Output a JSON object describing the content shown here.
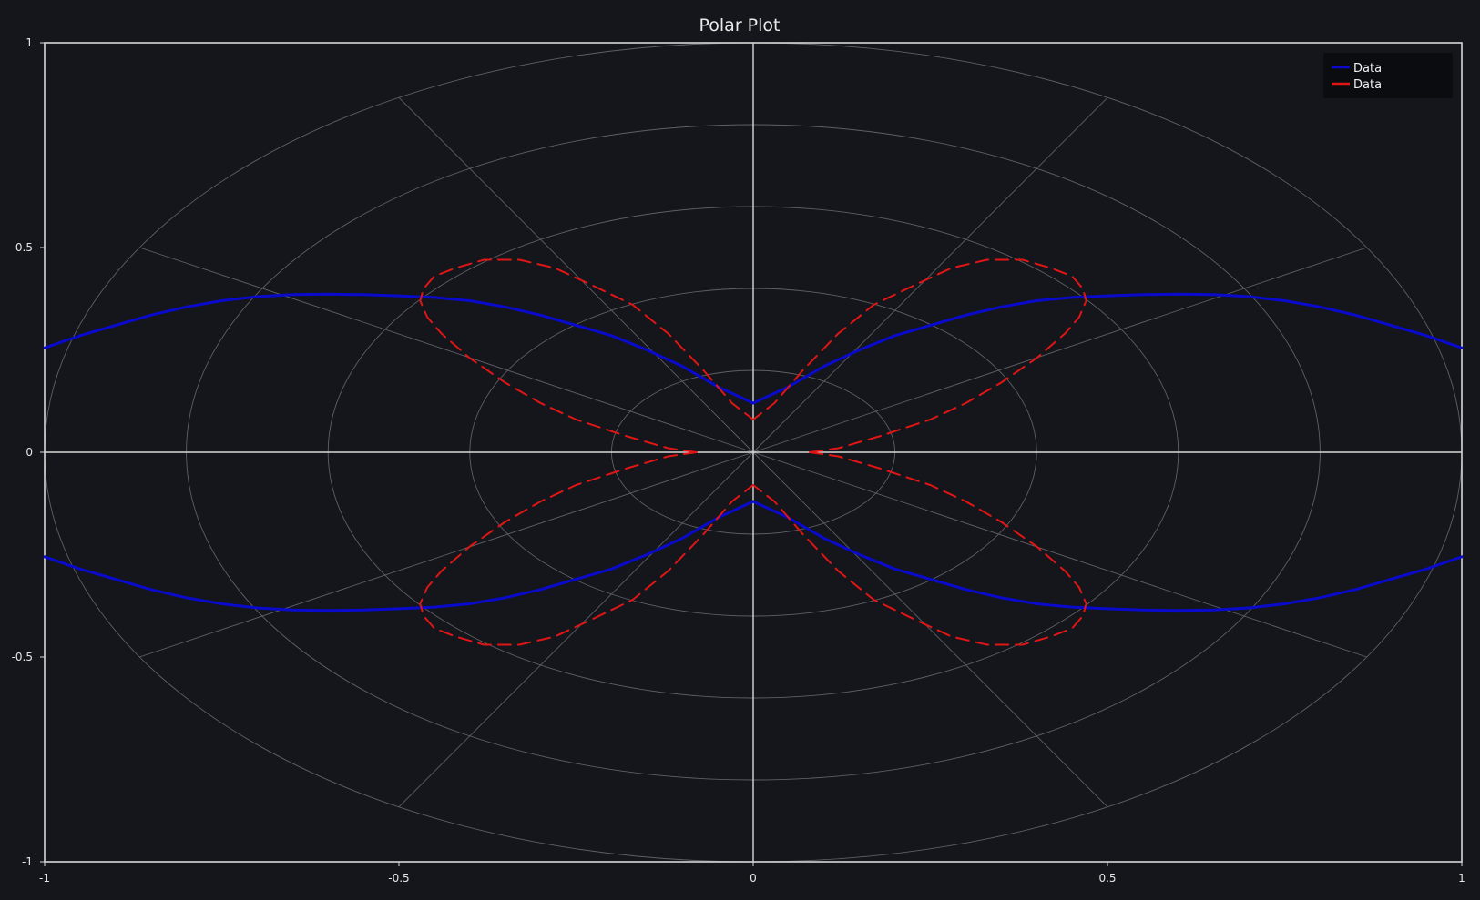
{
  "chart_data": {
    "type": "line",
    "title": "Polar Plot",
    "xlabel": "",
    "ylabel": "",
    "xlim": [
      -1,
      1
    ],
    "ylim": [
      -1,
      1
    ],
    "x_ticks": [
      -1,
      -0.5,
      0,
      0.5,
      1
    ],
    "x_tick_labels": [
      "-1",
      "-0.5",
      "0",
      "0.5",
      "1"
    ],
    "y_ticks": [
      -1,
      -0.5,
      0,
      0.5,
      1
    ],
    "y_tick_labels": [
      "-1",
      "-0.5",
      "0",
      "0.5",
      "1"
    ],
    "grid": true,
    "polar_grid": {
      "radii": [
        0.2,
        0.4,
        0.6,
        0.8,
        1.0
      ],
      "spoke_angles_deg": [
        0,
        30,
        60,
        90,
        120,
        150,
        180,
        210,
        240,
        270,
        300,
        330
      ]
    },
    "legend_position": "top-right",
    "series": [
      {
        "name": "Data",
        "color": "#0a0acc",
        "dash": "solid",
        "formula": "r = |sin(2*theta)| + 0.12 (symmetric about both axes)",
        "x": [
          0.0,
          0.05,
          0.1,
          0.15,
          0.2,
          0.25,
          0.3,
          0.35,
          0.4,
          0.45,
          0.5,
          0.55,
          0.6,
          0.65,
          0.7,
          0.75,
          0.8,
          0.85,
          0.9,
          0.95,
          1.0
        ],
        "y": [
          0.12,
          0.16,
          0.21,
          0.25,
          0.285,
          0.31,
          0.335,
          0.355,
          0.37,
          0.378,
          0.382,
          0.385,
          0.386,
          0.385,
          0.38,
          0.37,
          0.355,
          0.335,
          0.31,
          0.285,
          0.255
        ]
      },
      {
        "name": "Data",
        "color": "#e01515",
        "dash": "dashed",
        "formula": "r = |sin(2*theta)|^0.4 * 0.68 + 0.08 (four-leaf rose)",
        "x": [
          0.08,
          0.12,
          0.18,
          0.25,
          0.3,
          0.35,
          0.4,
          0.44,
          0.46,
          0.47,
          0.465,
          0.45,
          0.42,
          0.38,
          0.33,
          0.28,
          0.23,
          0.17,
          0.12,
          0.07,
          0.03,
          0.0
        ],
        "y": [
          0.0,
          0.01,
          0.04,
          0.08,
          0.12,
          0.17,
          0.23,
          0.29,
          0.33,
          0.37,
          0.4,
          0.43,
          0.45,
          0.47,
          0.47,
          0.45,
          0.41,
          0.36,
          0.29,
          0.2,
          0.12,
          0.08
        ]
      }
    ]
  }
}
